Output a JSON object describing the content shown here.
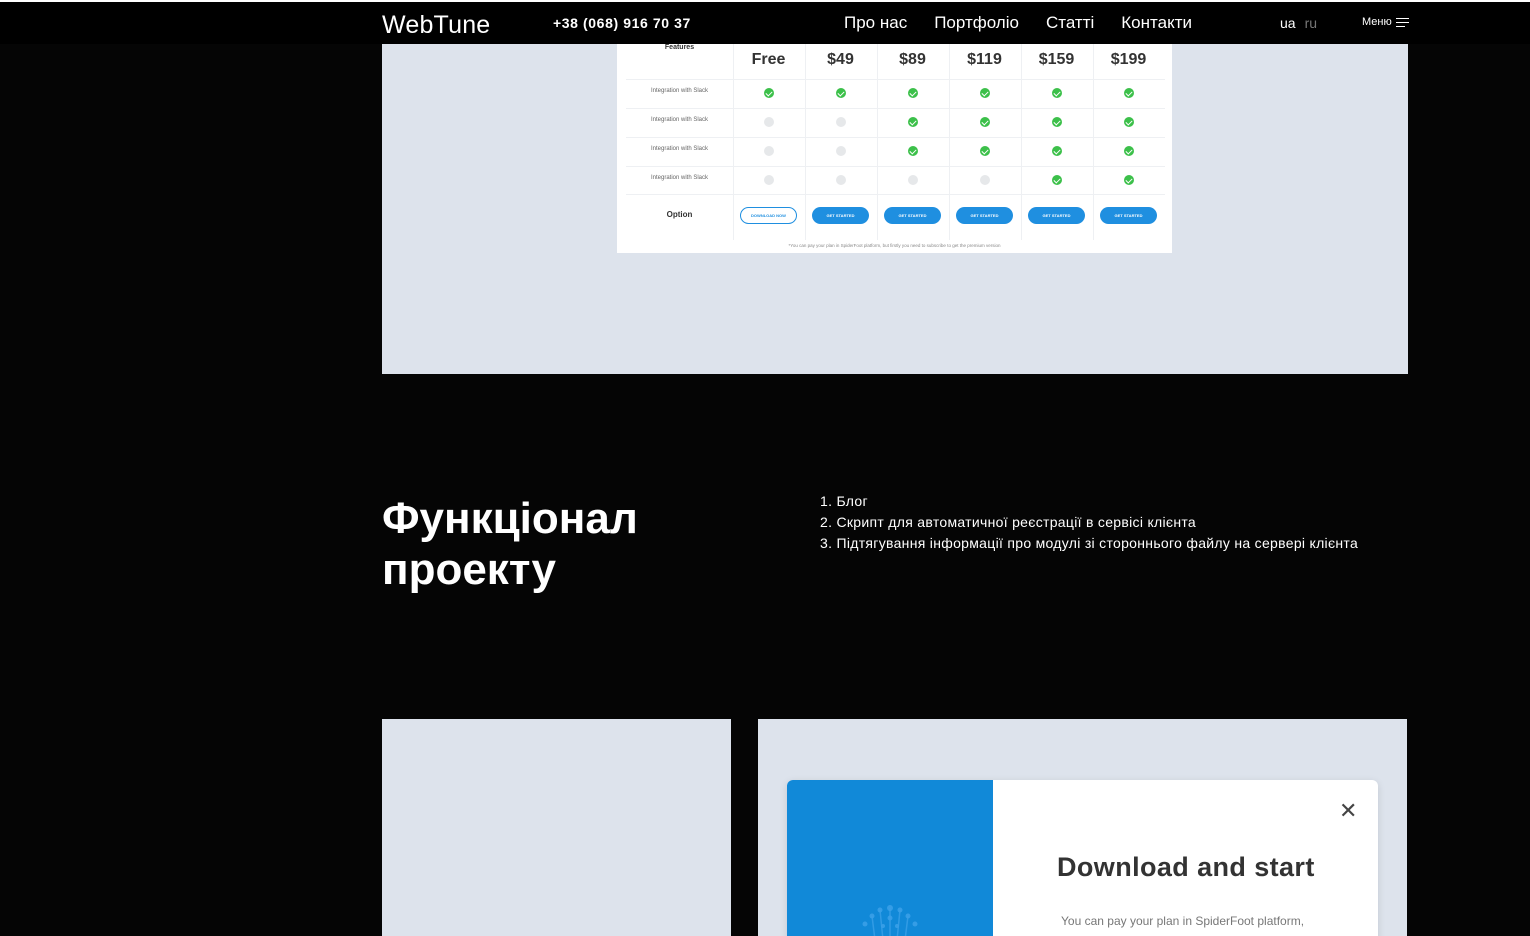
{
  "header": {
    "logo": "WebTune",
    "phone": "+38 (068) 916 70 37",
    "nav": [
      "Про нас",
      "Портфоліо",
      "Статті",
      "Контакти"
    ],
    "lang": {
      "active": "ua",
      "inactive": "ru"
    },
    "menu_label": "Меню"
  },
  "pricing_preview": {
    "features_header": "Features",
    "prices": [
      "Free",
      "$49",
      "$89",
      "$119",
      "$159",
      "$199"
    ],
    "rows": [
      {
        "label": "Integration with Slack",
        "checks": [
          true,
          true,
          true,
          true,
          true,
          true
        ]
      },
      {
        "label": "Integration with Slack",
        "checks": [
          false,
          false,
          true,
          true,
          true,
          true
        ]
      },
      {
        "label": "Integration with Slack",
        "checks": [
          false,
          false,
          true,
          true,
          true,
          true
        ]
      },
      {
        "label": "Integration with Slack",
        "checks": [
          false,
          false,
          false,
          false,
          true,
          true
        ]
      }
    ],
    "option_label": "Option",
    "buttons": [
      "DOWNLOAD NOW",
      "GET STARTED",
      "GET STARTED",
      "GET STARTED",
      "GET STARTED",
      "GET STARTED"
    ],
    "note": "*You can pay your plan in SpiderFoot platform, but firstly you need to subscribe to get the premium version",
    "colors": {
      "check": "#3cc04a",
      "button": "#1f8fe0"
    }
  },
  "features": {
    "title_line1": "Функціонал",
    "title_line2": "проекту",
    "items": [
      "1. Блог",
      "2. Скрипт для автоматичної реєстрації в сервісі клієнта",
      "3. Підтягування інформації про модулі зі стороннього файлу на сервері клієнта"
    ]
  },
  "modal_preview": {
    "close_icon": "close-icon",
    "title": "Download and start",
    "subtitle": "You can pay your plan in SpiderFoot platform,",
    "accent": "#1189d8"
  }
}
